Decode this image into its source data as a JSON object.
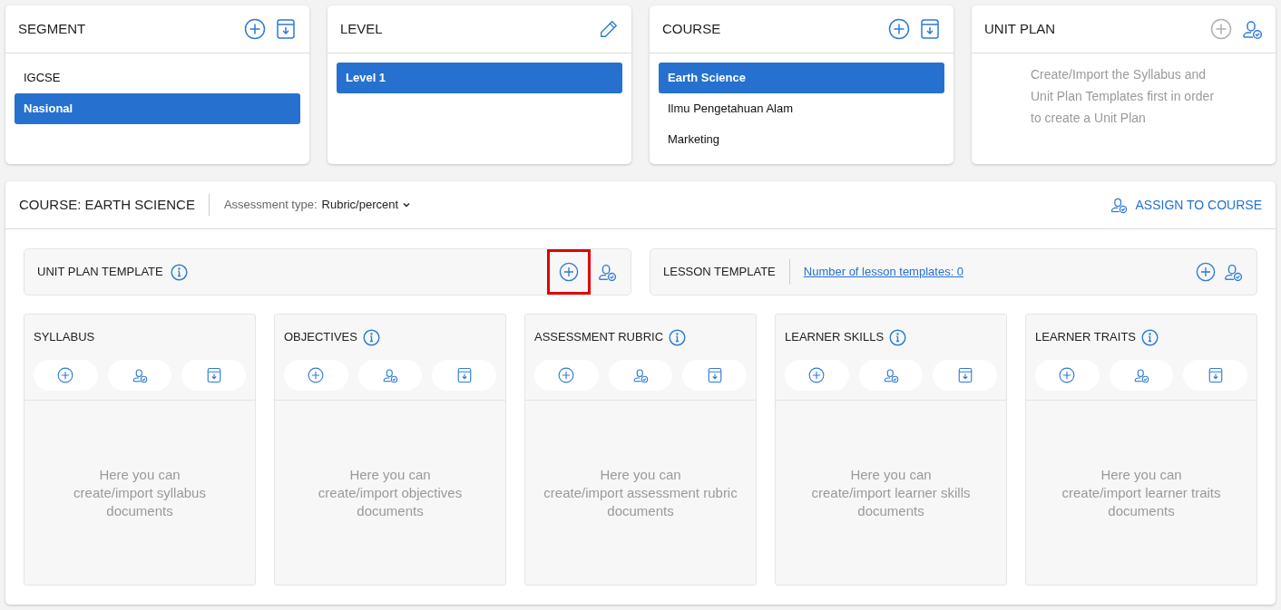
{
  "cards": [
    {
      "title": "SEGMENT",
      "actions": [
        {
          "kind": "add",
          "disabled": false
        },
        {
          "kind": "import",
          "disabled": false
        }
      ],
      "items": [
        {
          "label": "IGCSE",
          "selected": false
        },
        {
          "label": "Nasional",
          "selected": true
        }
      ]
    },
    {
      "title": "LEVEL",
      "actions": [
        {
          "kind": "edit",
          "disabled": false
        }
      ],
      "items": [
        {
          "label": "Level 1",
          "selected": true
        }
      ]
    },
    {
      "title": "COURSE",
      "actions": [
        {
          "kind": "add",
          "disabled": false
        },
        {
          "kind": "import",
          "disabled": false
        }
      ],
      "items": [
        {
          "label": "Earth Science",
          "selected": true
        },
        {
          "label": "Ilmu Pengetahuan Alam",
          "selected": false
        },
        {
          "label": "Marketing",
          "selected": false
        }
      ]
    },
    {
      "title": "UNIT PLAN",
      "actions": [
        {
          "kind": "add",
          "disabled": true
        },
        {
          "kind": "assign",
          "disabled": false
        }
      ],
      "message": "Create/Import the Syllabus and Unit Plan Templates first in order to create a Unit Plan"
    }
  ],
  "course_panel": {
    "title": "COURSE: EARTH SCIENCE",
    "assessment_label": "Assessment type:",
    "assessment_value": "Rubric/percent",
    "assign_button": "ASSIGN TO COURSE",
    "templates": [
      {
        "title": "UNIT PLAN TEMPLATE",
        "info": true,
        "actions": [
          {
            "kind": "add",
            "highlighted": true
          },
          {
            "kind": "assign",
            "highlighted": false
          }
        ]
      },
      {
        "title": "LESSON TEMPLATE",
        "info": false,
        "link": "Number of lesson templates: 0",
        "actions": [
          {
            "kind": "add",
            "highlighted": false
          },
          {
            "kind": "assign",
            "highlighted": false
          }
        ]
      }
    ],
    "columns": [
      {
        "title": "SYLLABUS",
        "info": false,
        "message": "Here you can\ncreate/import syllabus\ndocuments"
      },
      {
        "title": "OBJECTIVES",
        "info": true,
        "message": "Here you can\ncreate/import objectives\ndocuments"
      },
      {
        "title": "ASSESSMENT RUBRIC",
        "info": true,
        "message": "Here you can\ncreate/import assessment rubric\ndocuments"
      },
      {
        "title": "LEARNER SKILLS",
        "info": true,
        "message": "Here you can\ncreate/import learner skills\ndocuments"
      },
      {
        "title": "LEARNER TRAITS",
        "info": true,
        "message": "Here you can\ncreate/import learner traits\ndocuments"
      }
    ]
  }
}
